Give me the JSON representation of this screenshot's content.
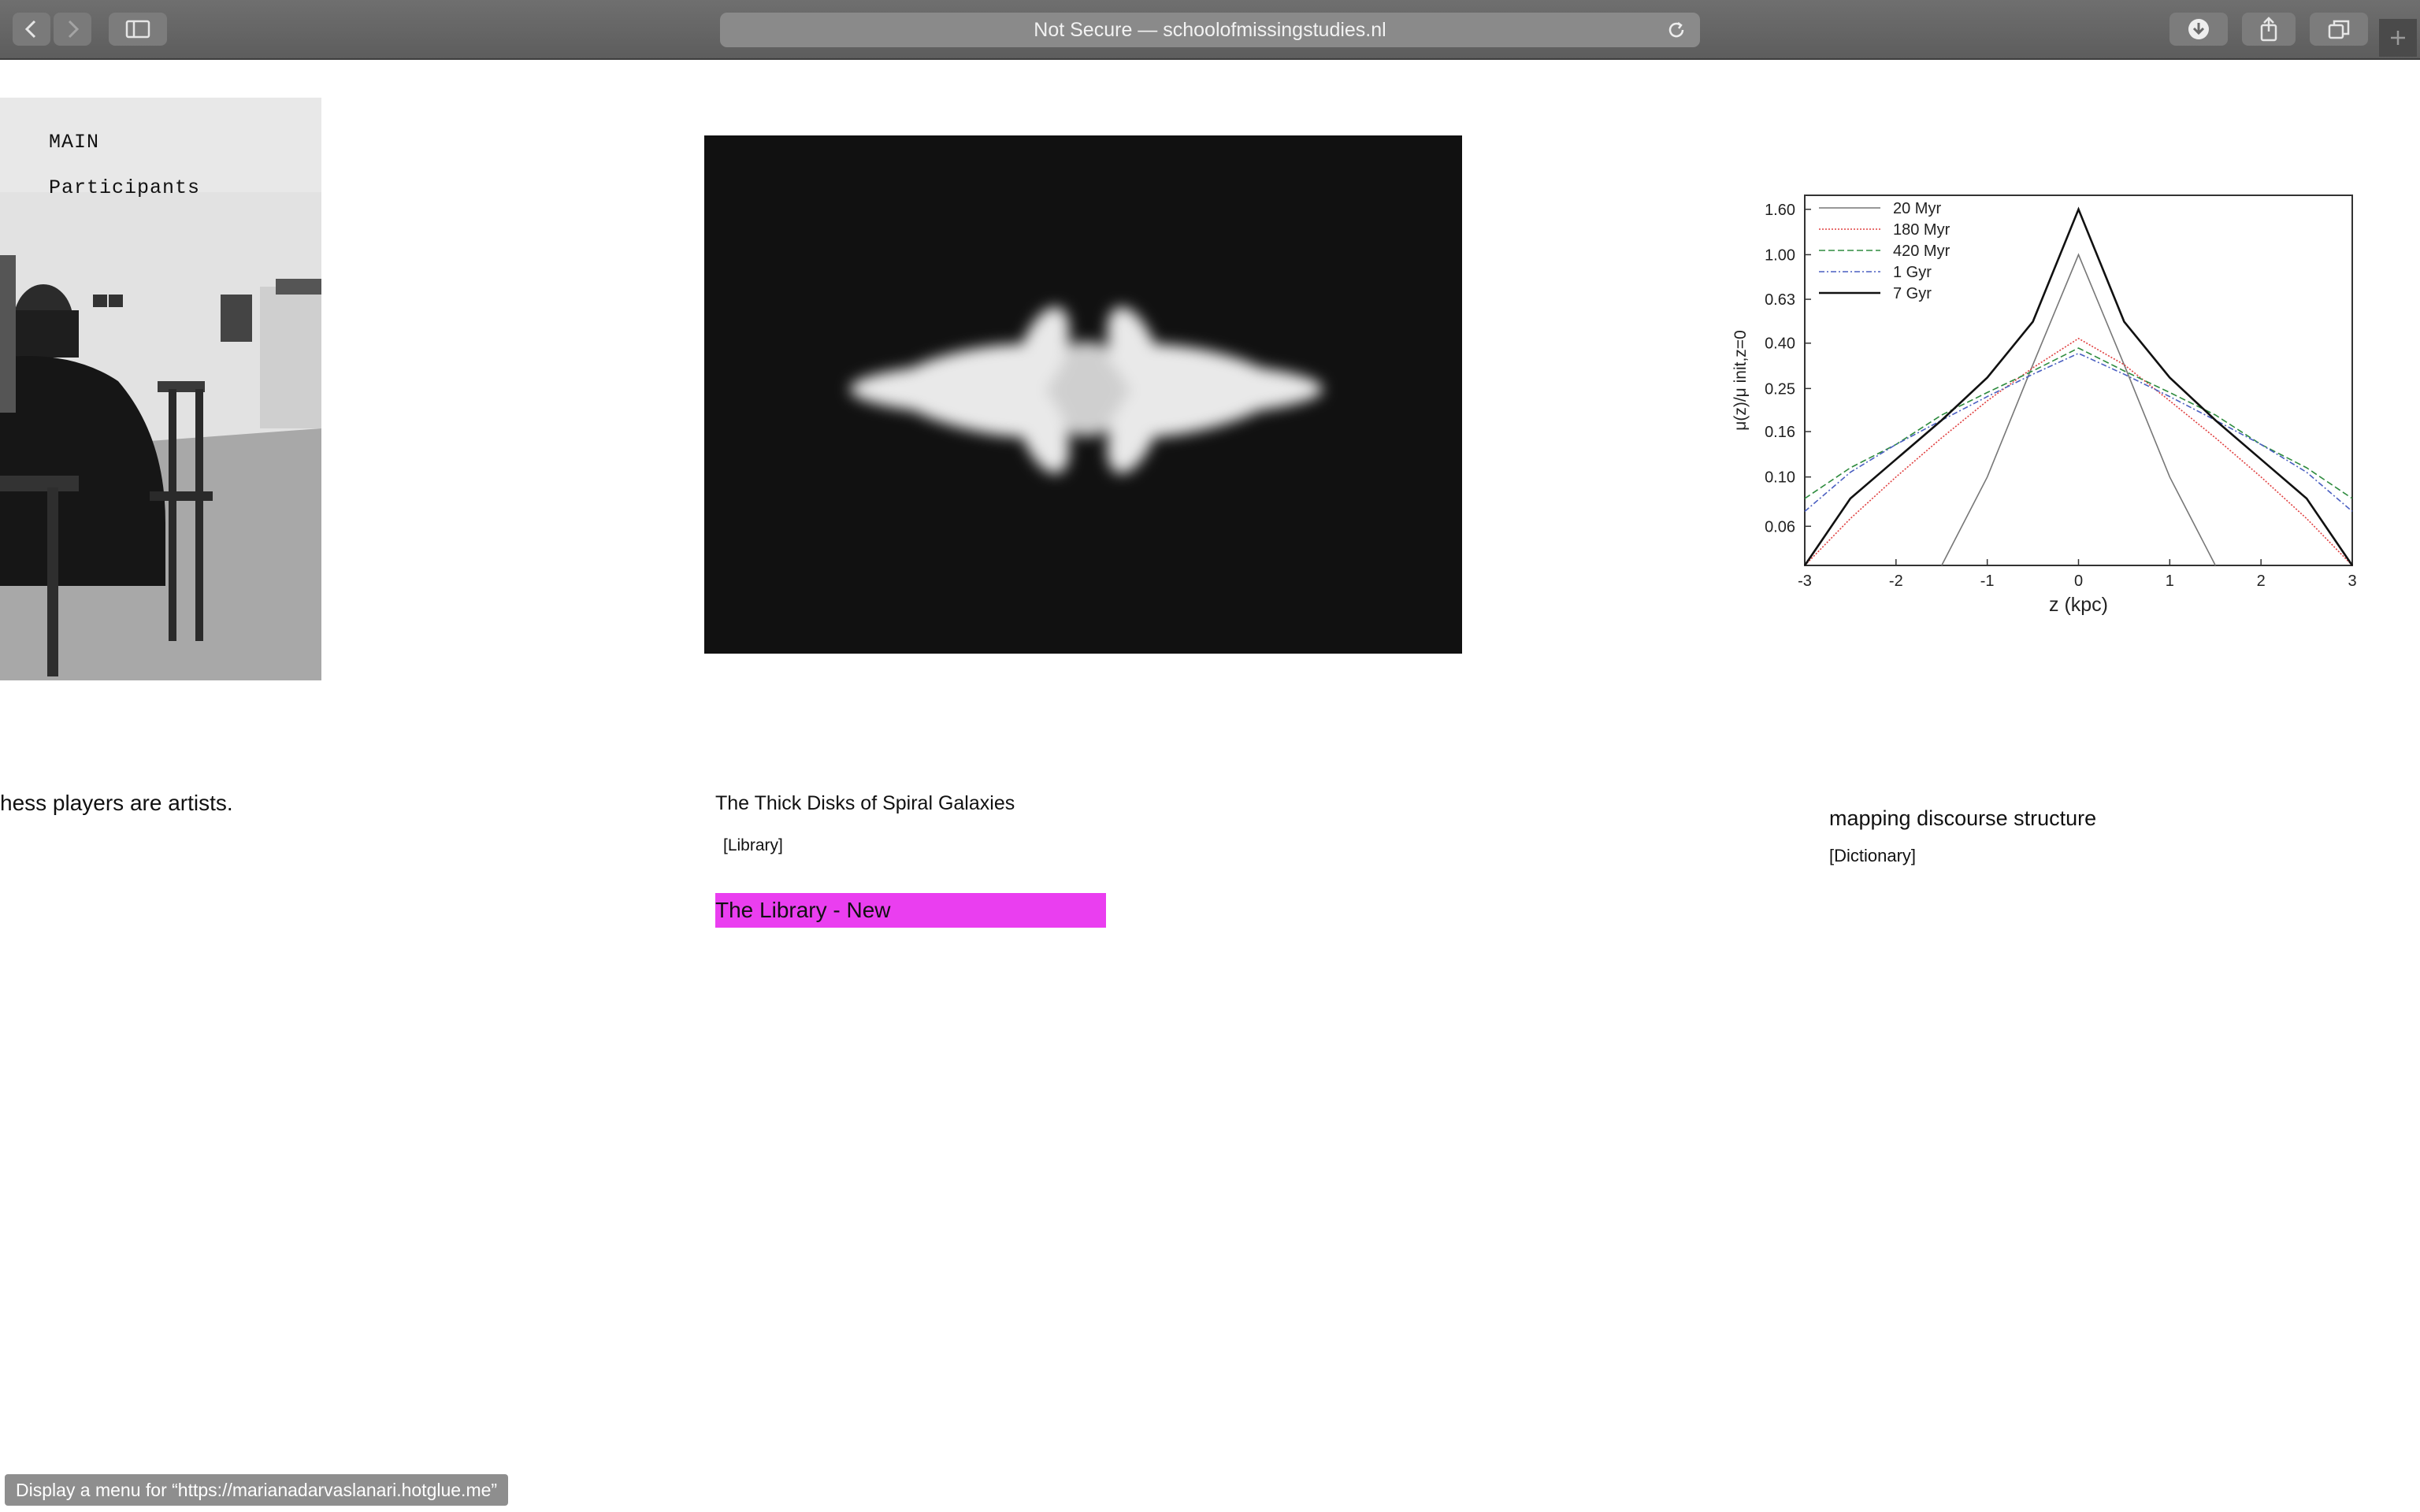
{
  "browser": {
    "address_text": "Not Secure — schoolofmissingstudies.nl",
    "icons": [
      "back-arrow-icon",
      "forward-arrow-icon",
      "sidebar-icon",
      "reload-icon",
      "download-icon",
      "share-icon",
      "tabs-icon",
      "plus-icon"
    ]
  },
  "left_column": {
    "menu": [
      "MAIN",
      "Participants"
    ],
    "caption": "hess players are artists."
  },
  "center_column": {
    "title": "The Thick Disks of Spiral Galaxies",
    "tag": "[Library]",
    "highlight": "The Library - New"
  },
  "right_column": {
    "title": "mapping discourse structure",
    "tag": "[Dictionary]"
  },
  "status_bar": {
    "text": "Display a menu for “https://marianadarvaslanari.hotglue.me”"
  },
  "chart_data": {
    "type": "line",
    "xlabel": "z (kpc)",
    "ylabel": "μ(z)/μ init,z=0",
    "x_ticks": [
      "-3",
      "-2",
      "-1",
      "0",
      "1",
      "2",
      "3"
    ],
    "y_ticks": [
      "0.06",
      "0.10",
      "0.16",
      "0.25",
      "0.40",
      "0.63",
      "1.00",
      "1.60"
    ],
    "y_scale": "log",
    "xlim": [
      -3,
      3
    ],
    "ylim": [
      0.04,
      1.85
    ],
    "legend_position": "top-left",
    "x": [
      -3,
      -2.5,
      -2,
      -1.5,
      -1,
      -0.5,
      0,
      0.5,
      1,
      1.5,
      2,
      2.5,
      3
    ],
    "series": [
      {
        "name": "20 Myr",
        "color": "#777777",
        "dash": "",
        "width": 1.6,
        "values": [
          null,
          null,
          null,
          0.04,
          0.1,
          0.32,
          1.0,
          0.32,
          0.1,
          0.04,
          null,
          null,
          null
        ]
      },
      {
        "name": "180 Myr",
        "color": "#e04040",
        "dash": "2,2",
        "width": 1.6,
        "values": [
          0.04,
          0.065,
          0.1,
          0.15,
          0.22,
          0.31,
          0.42,
          0.32,
          0.22,
          0.15,
          0.1,
          0.065,
          0.04
        ]
      },
      {
        "name": "420 Myr",
        "color": "#2e8b3e",
        "dash": "8,4",
        "width": 1.6,
        "values": [
          0.08,
          0.11,
          0.14,
          0.19,
          0.24,
          0.3,
          0.38,
          0.3,
          0.24,
          0.19,
          0.14,
          0.11,
          0.08
        ]
      },
      {
        "name": "1 Gyr",
        "color": "#4a5fc1",
        "dash": "7,3,2,3",
        "width": 1.6,
        "values": [
          0.07,
          0.105,
          0.14,
          0.18,
          0.23,
          0.29,
          0.36,
          0.29,
          0.23,
          0.18,
          0.14,
          0.105,
          0.07
        ]
      },
      {
        "name": "7 Gyr",
        "color": "#111111",
        "dash": "",
        "width": 2.6,
        "values": [
          0.04,
          0.08,
          0.12,
          0.18,
          0.28,
          0.5,
          1.6,
          0.5,
          0.28,
          0.18,
          0.12,
          0.08,
          0.04
        ]
      }
    ]
  }
}
